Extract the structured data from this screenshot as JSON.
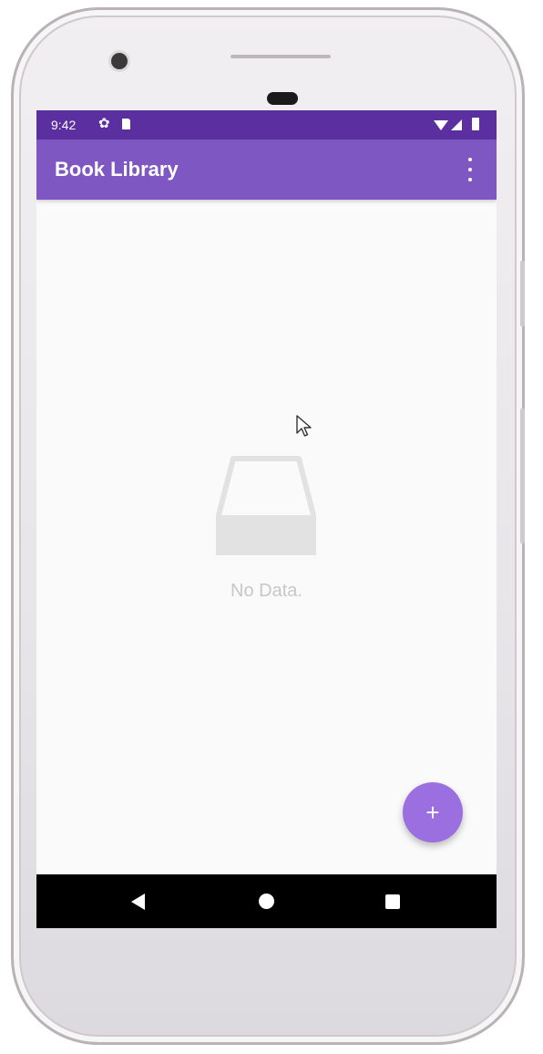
{
  "status_bar": {
    "time": "9:42",
    "icons": [
      "settings-gear-icon",
      "sd-card-icon",
      "wifi-icon",
      "signal-icon",
      "battery-icon"
    ]
  },
  "app_bar": {
    "title": "Book Library",
    "overflow_icon": "more-vert-icon",
    "color": "#7e57c2"
  },
  "status_bar_color": "#5b2fa0",
  "main": {
    "empty_icon": "empty-inbox-icon",
    "empty_text": "No Data."
  },
  "fab": {
    "label": "+",
    "icon": "add-icon",
    "color": "#9b6fe0"
  },
  "nav_bar": {
    "buttons": [
      "back-icon",
      "home-icon",
      "recents-icon"
    ]
  }
}
